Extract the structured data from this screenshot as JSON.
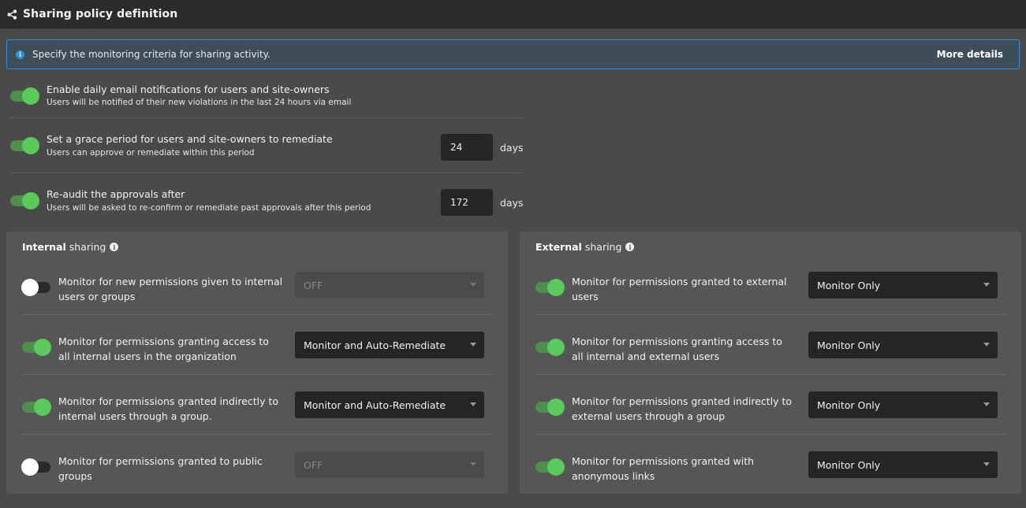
{
  "header": {
    "title": "Sharing policy definition",
    "icon": "share-icon"
  },
  "banner": {
    "text": "Specify the monitoring criteria for sharing activity.",
    "link": "More details"
  },
  "general": [
    {
      "title": "Enable daily email notifications for users and site-owners",
      "subtitle": "Users will be notified of their new violations in the last 24 hours via email",
      "enabled": true
    },
    {
      "title": "Set a grace period for users and site-owners to remediate",
      "subtitle": "Users can approve or remediate within this period",
      "enabled": true,
      "value": "24",
      "unit": "days"
    },
    {
      "title": "Re-audit the approvals after",
      "subtitle": "Users will be asked to re-confirm or remediate past approvals after this period",
      "enabled": true,
      "value": "172",
      "unit": "days"
    }
  ],
  "internal": {
    "title_bold": "Internal",
    "title_rest": "sharing",
    "rows": [
      {
        "text": "Monitor for new permissions given to internal users or groups",
        "enabled": false,
        "select": "OFF"
      },
      {
        "text": "Monitor for permissions granting access to all internal users in the organization",
        "enabled": true,
        "select": "Monitor and Auto-Remediate"
      },
      {
        "text": "Monitor for permissions granted indirectly to internal users through a group.",
        "enabled": true,
        "select": "Monitor and Auto-Remediate"
      },
      {
        "text": "Monitor for permissions granted to public groups",
        "enabled": false,
        "select": "OFF"
      }
    ]
  },
  "external": {
    "title_bold": "External",
    "title_rest": "sharing",
    "rows": [
      {
        "text": "Monitor for permissions granted to external users",
        "enabled": true,
        "select": "Monitor Only"
      },
      {
        "text": "Monitor for permissions granting access to all internal and external users",
        "enabled": true,
        "select": "Monitor Only"
      },
      {
        "text": "Monitor for permissions granted indirectly to external users through a group",
        "enabled": true,
        "select": "Monitor Only"
      },
      {
        "text": "Monitor for permissions granted with anonymous links",
        "enabled": true,
        "select": "Monitor Only"
      }
    ]
  },
  "colors": {
    "accent_blue": "#2f8fd8",
    "toggle_on": "#5bc95b",
    "panel_bg": "#565656"
  }
}
